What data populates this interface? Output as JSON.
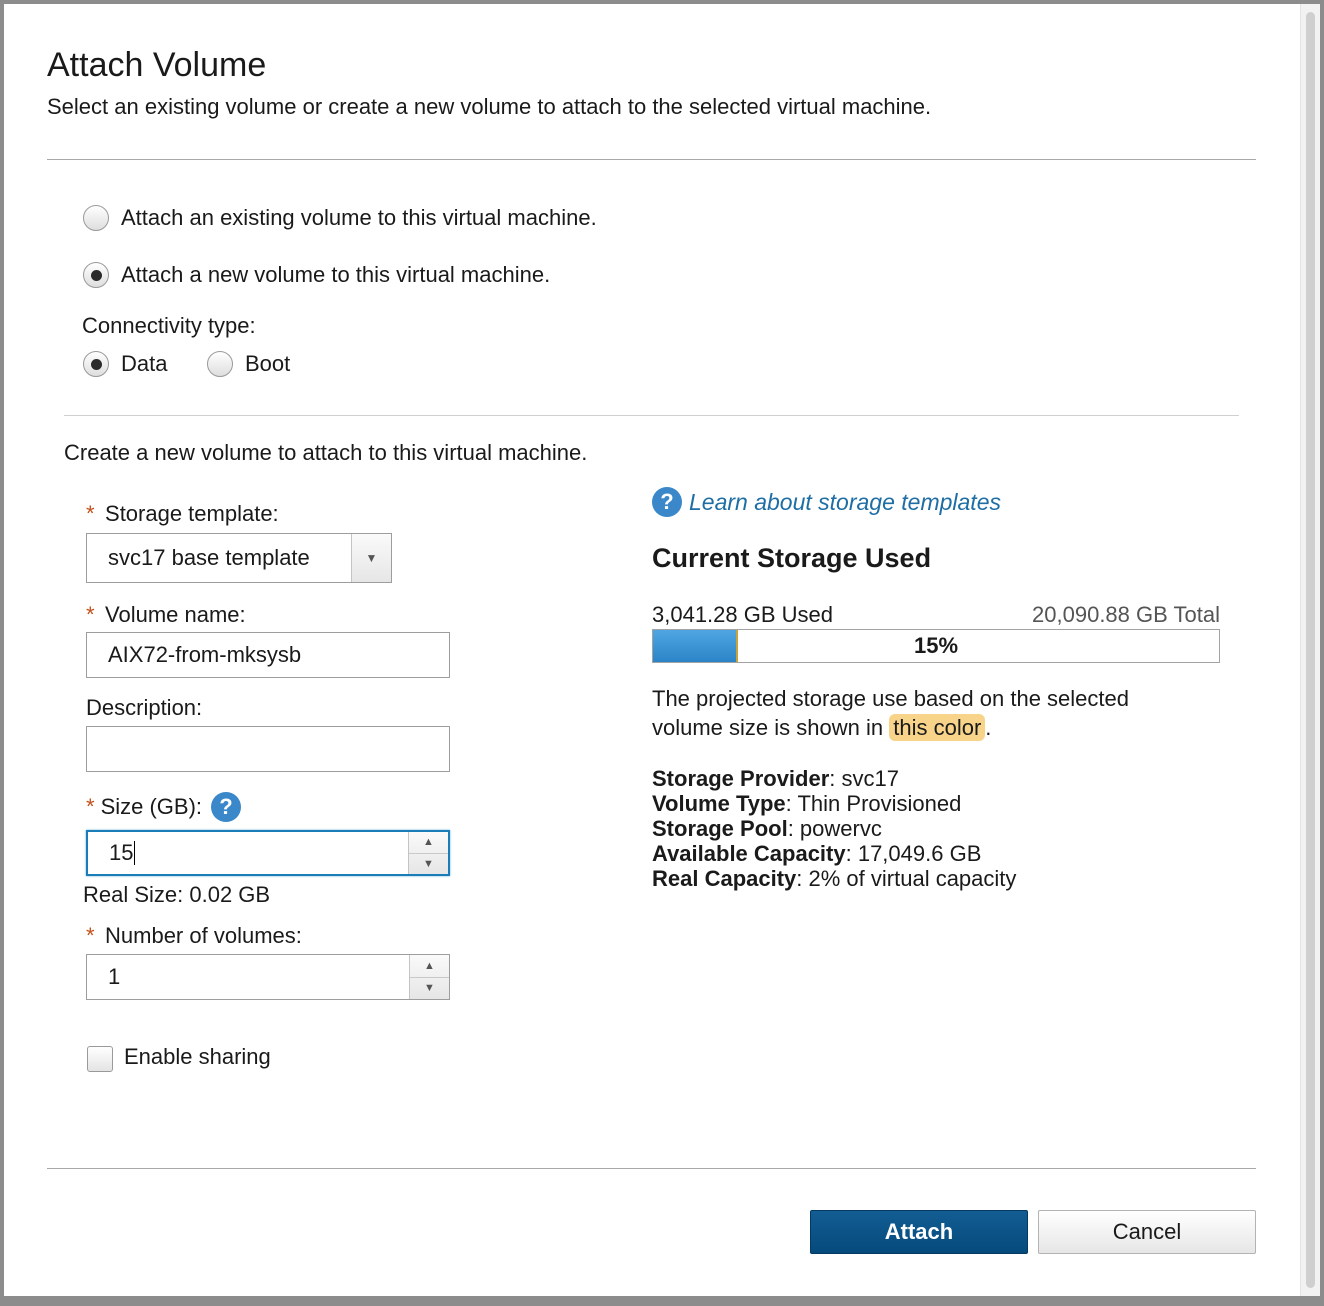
{
  "dialog": {
    "title": "Attach Volume",
    "subtitle": "Select an existing volume or create a new volume to attach to the selected virtual machine."
  },
  "attach_mode": {
    "options": [
      {
        "label": "Attach an existing volume to this virtual machine.",
        "checked": false
      },
      {
        "label": "Attach a new volume to this virtual machine.",
        "checked": true
      }
    ]
  },
  "connectivity": {
    "label": "Connectivity type:",
    "options": [
      {
        "label": "Data",
        "checked": true
      },
      {
        "label": "Boot",
        "checked": false
      }
    ]
  },
  "create_section": {
    "heading": "Create a new volume to attach to this virtual machine.",
    "required_marker": "*",
    "storage_template": {
      "label": "Storage template:",
      "value": "svc17 base template"
    },
    "volume_name": {
      "label": "Volume name:",
      "value": "AIX72-from-mksysb"
    },
    "description": {
      "label": "Description:",
      "value": ""
    },
    "size": {
      "label": "Size (GB):",
      "value": "15",
      "help_icon": "?"
    },
    "real_size": "Real Size: 0.02 GB",
    "number_of_volumes": {
      "label": "Number of volumes:",
      "value": "1"
    },
    "enable_sharing": {
      "label": "Enable sharing",
      "checked": false
    }
  },
  "storage_info": {
    "learn_link": "Learn about storage templates",
    "help_icon": "?",
    "heading": "Current Storage Used",
    "used_text": "3,041.28 GB Used",
    "total_text": "20,090.88 GB Total",
    "percent_label": "15%",
    "used_fraction": 0.15,
    "projected_text_1": "The projected storage use based on the selected",
    "projected_text_2": "volume size is shown in",
    "projected_highlight": "this color",
    "projected_end": ".",
    "properties": [
      {
        "key": "Storage Provider",
        "value": ": svc17"
      },
      {
        "key": "Volume Type",
        "value": ": Thin Provisioned"
      },
      {
        "key": "Storage Pool",
        "value": ": powervc"
      },
      {
        "key": "Available Capacity",
        "value": ": 17,049.6 GB"
      },
      {
        "key": "Real Capacity",
        "value": ": 2% of virtual capacity"
      }
    ]
  },
  "buttons": {
    "attach": "Attach",
    "cancel": "Cancel"
  },
  "colors": {
    "primary_button": "#0b5284",
    "link": "#1e6ea5",
    "required": "#c5501b",
    "projected_highlight": "#f8d48b",
    "bar_fill": "#3a93d6"
  }
}
